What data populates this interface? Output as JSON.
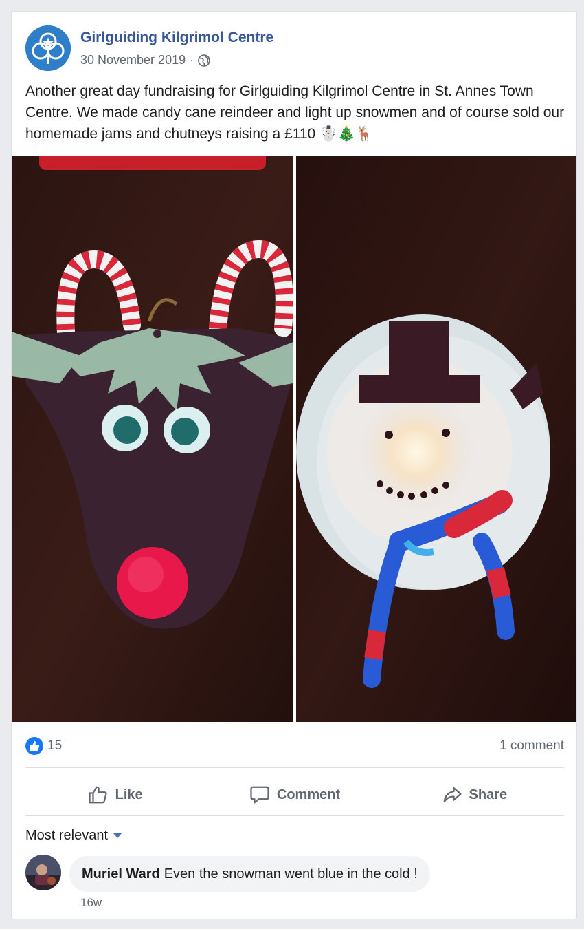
{
  "post": {
    "page_name": "Girlguiding Kilgrimol Centre",
    "date": "30 November 2019",
    "dot": "·",
    "privacy_icon": "globe-icon",
    "text": "Another great day fundraising for Girlguiding Kilgrimol Centre in St. Annes Town Centre. We made candy cane reindeer and light up snowmen and of course sold our homemade jams and chutneys raising a £110 ☃️🎄🦌"
  },
  "photos": [
    {
      "subject": "reindeer"
    },
    {
      "subject": "snowman"
    }
  ],
  "stats": {
    "likes": "15",
    "comments": "1 comment"
  },
  "actions": {
    "like": "Like",
    "comment": "Comment",
    "share": "Share"
  },
  "comments": {
    "sort_label": "Most relevant",
    "items": [
      {
        "author": "Muriel Ward",
        "text": "Even the snowman went blue in the cold !",
        "age": "16w"
      }
    ]
  },
  "colors": {
    "link": "#365899",
    "like_blue": "#1877f2",
    "muted": "#606770"
  }
}
